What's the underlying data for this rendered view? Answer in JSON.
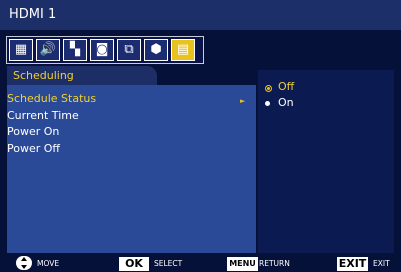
{
  "title": "HDMI 1",
  "icon_tabs": [
    {
      "icon": "picture-settings-icon",
      "glyph": "▦",
      "selected": false
    },
    {
      "icon": "speaker-icon",
      "glyph": "🔊",
      "selected": false
    },
    {
      "icon": "grid-layout-icon",
      "glyph": "▚",
      "selected": false
    },
    {
      "icon": "screen-adjust-icon",
      "glyph": "◙",
      "selected": false
    },
    {
      "icon": "display-network-icon",
      "glyph": "⧉",
      "selected": false
    },
    {
      "icon": "cube-icon",
      "glyph": "⬢",
      "selected": false
    },
    {
      "icon": "schedule-icon",
      "glyph": "▤",
      "selected": true
    }
  ],
  "section": "Scheduling",
  "menu_items": [
    {
      "label": "Schedule Status",
      "active": true
    },
    {
      "label": "Current Time",
      "active": false
    },
    {
      "label": "Power On",
      "active": false
    },
    {
      "label": "Power Off",
      "active": false
    }
  ],
  "options": [
    {
      "label": "Off",
      "selected": true
    },
    {
      "label": "On",
      "selected": false
    }
  ],
  "footer": {
    "move_label": "MOVE",
    "ok_key": "OK",
    "select_label": "SELECT",
    "menu_key": "MENU",
    "return_label": "RETURN",
    "exit_key": "EXIT",
    "exit_label": "EXIT"
  },
  "colors": {
    "background": "#06113a",
    "title_bar": "#1d2f68",
    "left_panel": "#2a4a98",
    "highlight": "#f0d030",
    "selected_tab": "#e8c21e"
  }
}
